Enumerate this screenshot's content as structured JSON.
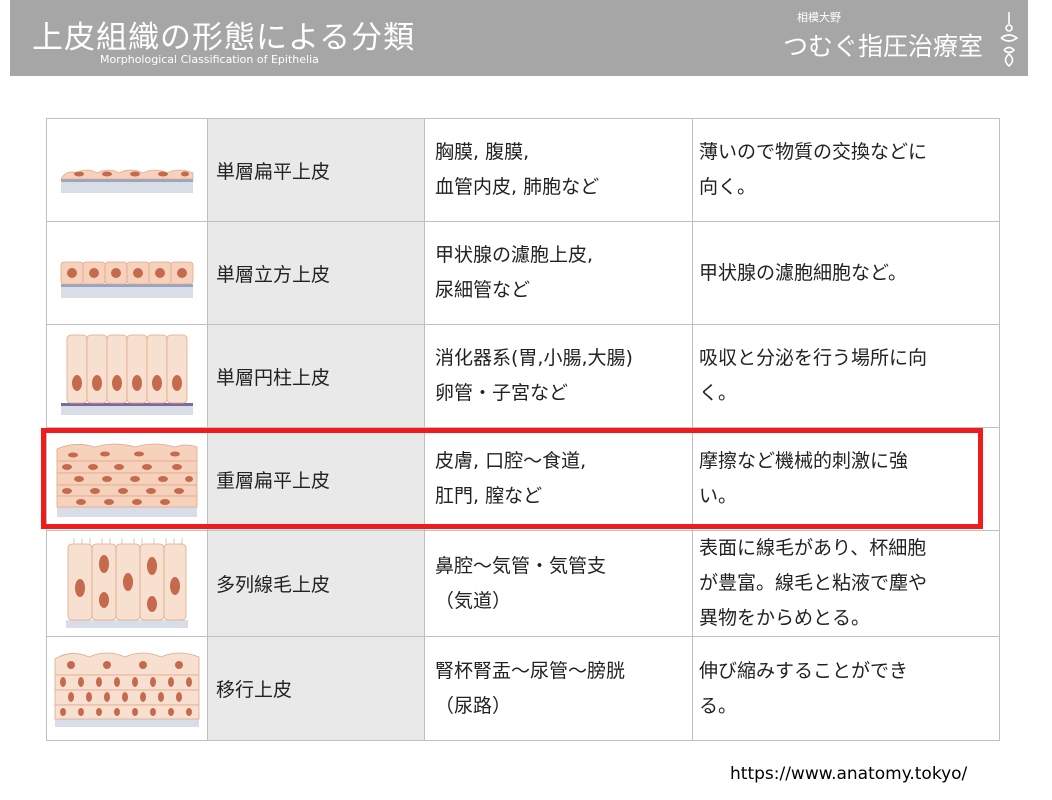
{
  "header": {
    "title": "上皮組織の形態による分類",
    "subtitle": "Morphological Classification of Epithelia",
    "brand_location": "相模大野",
    "brand_name": "つむぐ指圧治療室"
  },
  "table": {
    "rows": [
      {
        "name": "単層扁平上皮",
        "locations": "胸膜, 腹膜,\n血管内皮, 肺胞など",
        "function": "薄いので物質の交換などに\n向く。",
        "illustration": "simple-squamous-illustration"
      },
      {
        "name": "単層立方上皮",
        "locations": "甲状腺の濾胞上皮,\n尿細管など",
        "function": "甲状腺の濾胞細胞など。",
        "illustration": "simple-cuboidal-illustration"
      },
      {
        "name": "単層円柱上皮",
        "locations": "消化器系(胃,小腸,大腸)\n卵管・子宮など",
        "function": "吸収と分泌を行う場所に向\nく。",
        "illustration": "simple-columnar-illustration"
      },
      {
        "name": "重層扁平上皮",
        "locations": "皮膚, 口腔～食道,\n肛門, 膣など",
        "function": "摩擦など機械的刺激に強\nい。",
        "illustration": "stratified-squamous-illustration",
        "highlighted": true
      },
      {
        "name": "多列線毛上皮",
        "locations": "鼻腔～気管・気管支\n（気道）",
        "function": "表面に線毛があり、杯細胞\nが豊富。線毛と粘液で塵や\n異物をからめとる。",
        "illustration": "pseudostratified-ciliated-illustration"
      },
      {
        "name": "移行上皮",
        "locations": "腎杯腎盂～尿管～膀胱\n（尿路）",
        "function": "伸び縮みすることができ\nる。",
        "illustration": "transitional-illustration"
      }
    ]
  },
  "highlight_color": "#ee1c1c",
  "banner_color": "#a6a6a6",
  "source_url": "https://www.anatomy.tokyo/"
}
